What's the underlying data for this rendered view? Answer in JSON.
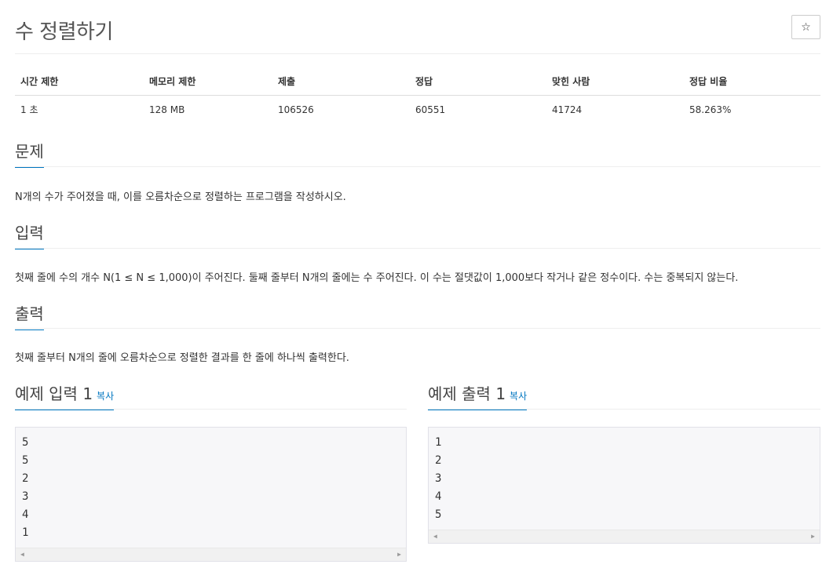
{
  "title": "수 정렬하기",
  "star_label": "☆",
  "info_table": {
    "headers": [
      "시간 제한",
      "메모리 제한",
      "제출",
      "정답",
      "맞힌 사람",
      "정답 비율"
    ],
    "values": [
      "1 초",
      "128 MB",
      "106526",
      "60551",
      "41724",
      "58.263%"
    ]
  },
  "sections": {
    "problem": {
      "heading": "문제",
      "text": "N개의 수가 주어졌을 때, 이를 오름차순으로 정렬하는 프로그램을 작성하시오."
    },
    "input": {
      "heading": "입력",
      "text": "첫째 줄에 수의 개수 N(1 ≤ N ≤ 1,000)이 주어진다. 둘째 줄부터 N개의 줄에는 수 주어진다. 이 수는 절댓값이 1,000보다 작거나 같은 정수이다. 수는 중복되지 않는다."
    },
    "output": {
      "heading": "출력",
      "text": "첫째 줄부터 N개의 줄에 오름차순으로 정렬한 결과를 한 줄에 하나씩 출력한다."
    }
  },
  "samples": {
    "input": {
      "heading": "예제 입력 1",
      "copy": "복사",
      "lines": [
        "5",
        "5",
        "2",
        "3",
        "4",
        "1"
      ]
    },
    "output": {
      "heading": "예제 출력 1",
      "copy": "복사",
      "lines": [
        "1",
        "2",
        "3",
        "4",
        "5"
      ]
    }
  },
  "scroll": {
    "left": "◀",
    "right": "▶"
  }
}
